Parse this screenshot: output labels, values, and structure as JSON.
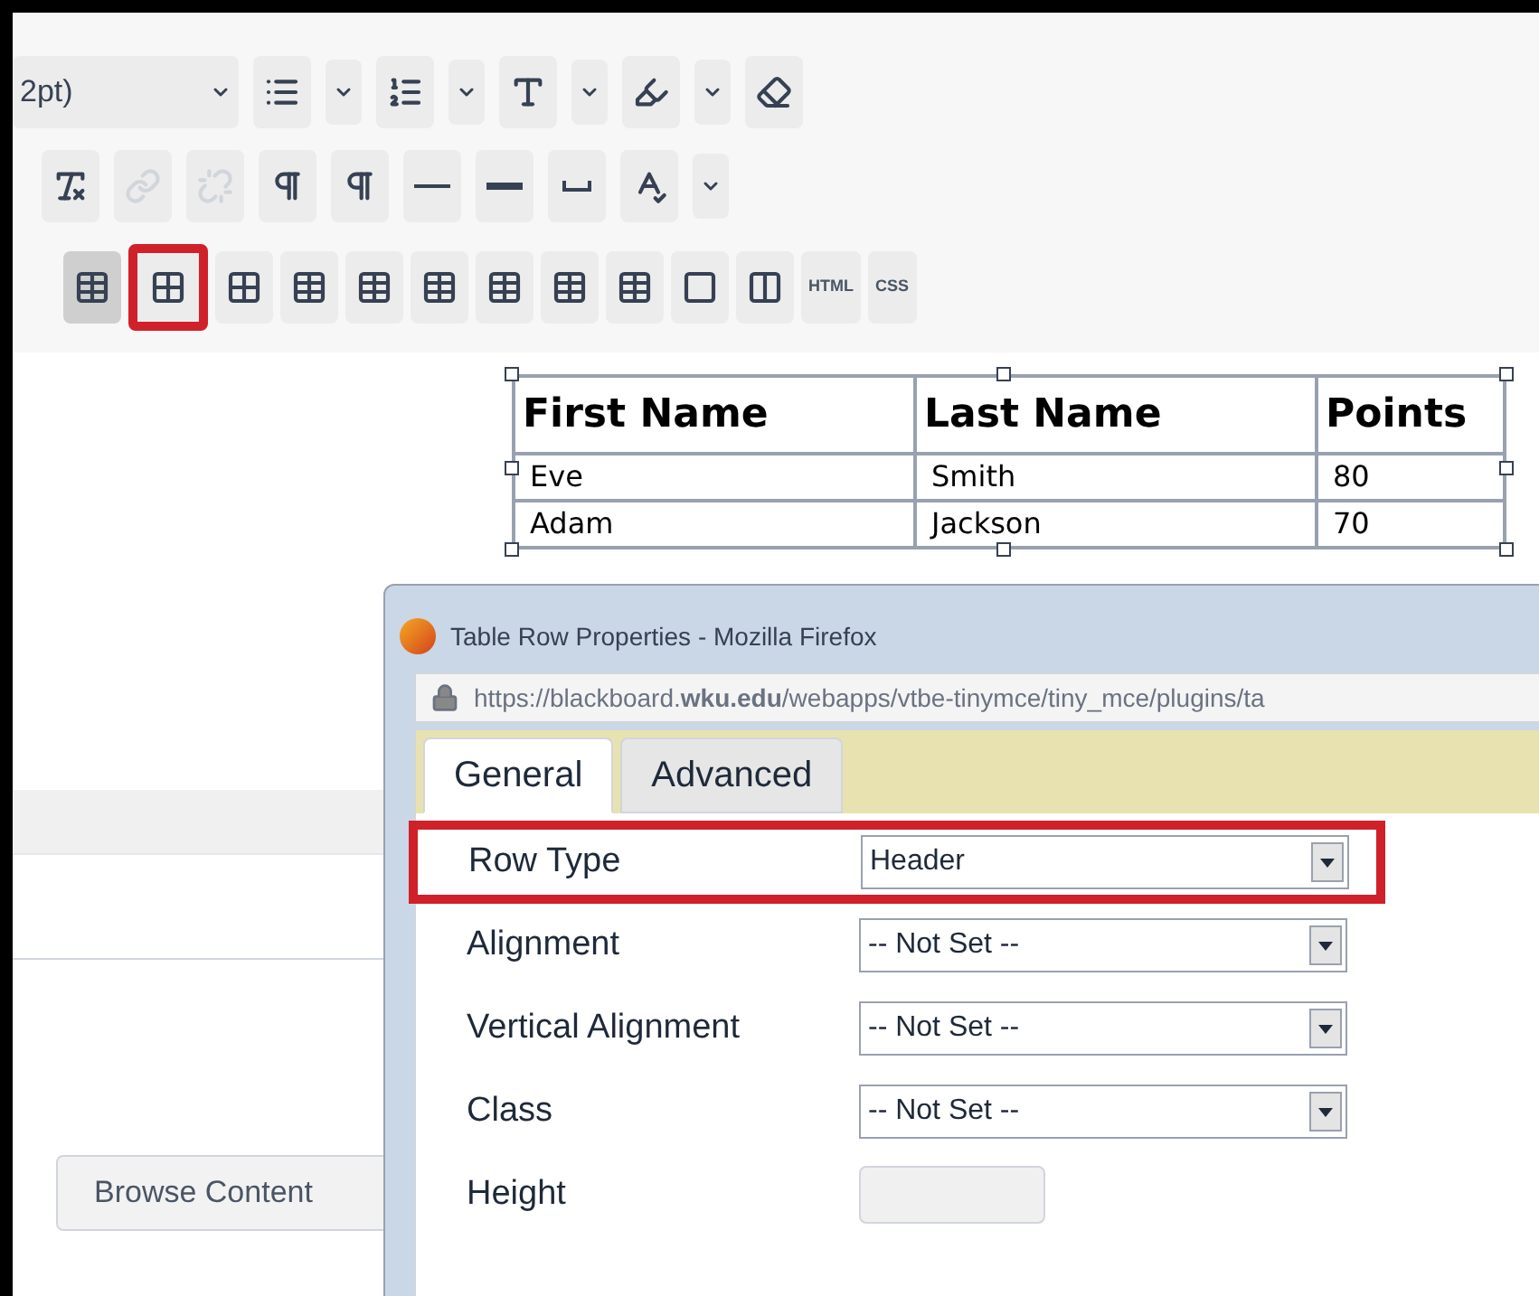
{
  "toolbar": {
    "font_size": {
      "value": "2pt)"
    },
    "row_1": [
      {
        "kind": "bullet-list"
      },
      {
        "kind": "caret"
      },
      {
        "kind": "numbered-list"
      },
      {
        "kind": "caret"
      },
      {
        "kind": "text-color"
      },
      {
        "kind": "caret"
      },
      {
        "kind": "highlighter"
      },
      {
        "kind": "caret"
      },
      {
        "kind": "eraser"
      }
    ],
    "row_2": [
      {
        "kind": "clear-format",
        "disabled": false
      },
      {
        "kind": "link",
        "disabled": true
      },
      {
        "kind": "unlink",
        "disabled": true
      },
      {
        "kind": "ltr",
        "disabled": false
      },
      {
        "kind": "rtl",
        "disabled": false
      },
      {
        "kind": "rule-thin",
        "disabled": false
      },
      {
        "kind": "rule-thick",
        "disabled": false
      },
      {
        "kind": "nbsp",
        "disabled": false
      },
      {
        "kind": "spellcheck",
        "disabled": false
      },
      {
        "kind": "caret"
      }
    ],
    "row_3": [
      {
        "kind": "table",
        "pressed": true,
        "highlighted": false
      },
      {
        "kind": "table-row",
        "pressed": false,
        "highlighted": true
      },
      {
        "kind": "table-cell",
        "pressed": false,
        "highlighted": false
      },
      {
        "kind": "table-row-before",
        "pressed": false,
        "highlighted": false
      },
      {
        "kind": "table-row-after",
        "pressed": false,
        "highlighted": false
      },
      {
        "kind": "table-row-delete",
        "pressed": false,
        "highlighted": false
      },
      {
        "kind": "table-col-before",
        "pressed": false,
        "highlighted": false
      },
      {
        "kind": "table-col-after",
        "pressed": false,
        "highlighted": false
      },
      {
        "kind": "table-col-delete",
        "pressed": false,
        "highlighted": false
      },
      {
        "kind": "merge",
        "pressed": false,
        "highlighted": false
      },
      {
        "kind": "split",
        "pressed": false,
        "highlighted": false
      },
      {
        "kind": "text",
        "label": "HTML",
        "pressed": false,
        "highlighted": false
      },
      {
        "kind": "text",
        "label": "CSS",
        "pressed": false,
        "highlighted": false
      }
    ]
  },
  "table": {
    "columns": [
      "First Name",
      "Last Name",
      "Points"
    ],
    "rows": [
      [
        "Eve",
        "Smith",
        "80"
      ],
      [
        "Adam",
        "Jackson",
        "70"
      ]
    ]
  },
  "browse_button": "Browse Content",
  "dialog": {
    "title": "Table Row Properties - Mozilla Firefox",
    "url": "https://blackboard.**wku.edu**/webapps/vtbe-tinymce/tiny_mce/plugins/ta",
    "tabs": [
      {
        "label": "General",
        "selected": true
      },
      {
        "label": "Advanced",
        "selected": false
      }
    ],
    "fields": [
      {
        "label": "Row Type",
        "kind": "select",
        "value": "Header",
        "highlighted": true
      },
      {
        "label": "Alignment",
        "kind": "select",
        "value": "-- Not Set --",
        "highlighted": false
      },
      {
        "label": "Vertical Alignment",
        "kind": "select",
        "value": "-- Not Set --",
        "highlighted": false
      },
      {
        "label": "Class",
        "kind": "select",
        "value": "-- Not Set --",
        "highlighted": false
      },
      {
        "label": "Height",
        "kind": "text",
        "highlighted": false
      }
    ]
  }
}
